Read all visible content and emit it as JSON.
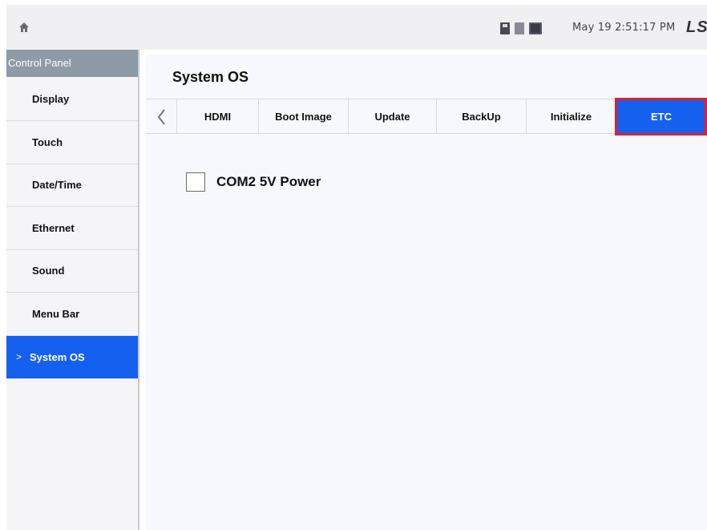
{
  "topbar": {
    "home_icon": "home-icon",
    "status_icons": [
      "sd-card-icon",
      "storage-icon",
      "monitor-icon"
    ],
    "datetime": "May 19 2:51:17 PM",
    "brand": "LS"
  },
  "sidebar": {
    "header": "Control Panel",
    "items": [
      {
        "label": "Display",
        "active": false
      },
      {
        "label": "Touch",
        "active": false
      },
      {
        "label": "Date/Time",
        "active": false
      },
      {
        "label": "Ethernet",
        "active": false
      },
      {
        "label": "Sound",
        "active": false
      },
      {
        "label": "Menu Bar",
        "active": false
      },
      {
        "label": "System OS",
        "active": true
      }
    ],
    "active_marker": ">"
  },
  "main": {
    "title": "System OS",
    "tabs": [
      {
        "label": "HDMI",
        "active": false
      },
      {
        "label": "Boot Image",
        "active": false
      },
      {
        "label": "Update",
        "active": false
      },
      {
        "label": "BackUp",
        "active": false
      },
      {
        "label": "Initialize",
        "active": false
      },
      {
        "label": "ETC",
        "active": true
      }
    ],
    "options": [
      {
        "label": "COM2 5V Power",
        "checked": false
      }
    ]
  },
  "colors": {
    "accent": "#1660f0",
    "highlight_border": "#e0202a",
    "sidebar_header": "#8e9aa6"
  }
}
